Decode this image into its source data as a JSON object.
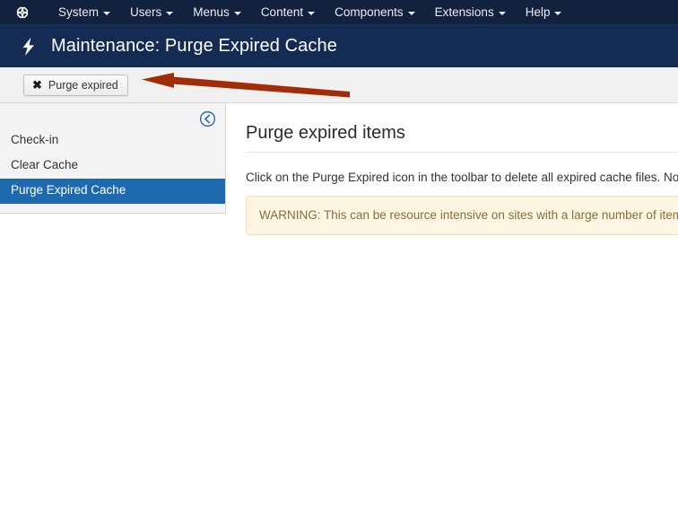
{
  "topbar": {
    "logo_icon": "joomla-logo-icon",
    "menus": [
      {
        "label": "System",
        "icon": "chevron-down-icon"
      },
      {
        "label": "Users",
        "icon": "chevron-down-icon"
      },
      {
        "label": "Menus",
        "icon": "chevron-down-icon"
      },
      {
        "label": "Content",
        "icon": "chevron-down-icon"
      },
      {
        "label": "Components",
        "icon": "chevron-down-icon"
      },
      {
        "label": "Extensions",
        "icon": "chevron-down-icon"
      },
      {
        "label": "Help",
        "icon": "chevron-down-icon"
      }
    ]
  },
  "header": {
    "icon": "lightning-bolt-icon",
    "title": "Maintenance: Purge Expired Cache",
    "background_color": "#142c53"
  },
  "toolbar": {
    "purge_button_label": "Purge expired",
    "purge_button_icon": "x-mark-icon",
    "annotation": {
      "name": "annotation-arrow",
      "color": "#a12c08",
      "direction": "left"
    }
  },
  "sidebar": {
    "collapse_icon": "circle-arrow-left-icon",
    "items": [
      {
        "label": "Check-in",
        "active": false
      },
      {
        "label": "Clear Cache",
        "active": false
      },
      {
        "label": "Purge Expired Cache",
        "active": true
      }
    ],
    "active_color": "#1d6aae"
  },
  "content": {
    "heading": "Purge expired items",
    "paragraph": "Click on the Purge Expired icon in the toolbar to delete all expired cache files. Note",
    "warning": "WARNING: This can be resource intensive on sites with a large number of items",
    "warning_bg": "#fcf6e3",
    "warning_text_color": "#8a6d3b"
  }
}
